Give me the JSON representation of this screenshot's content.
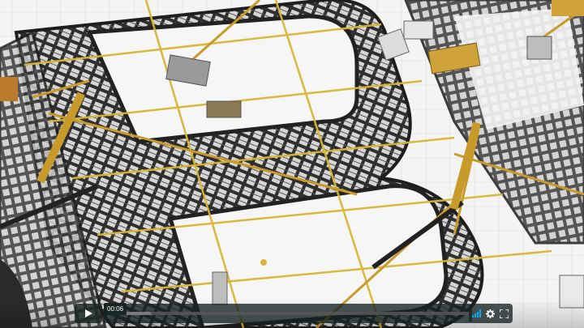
{
  "player": {
    "current_time": "00:06",
    "progress_fraction": 0.035,
    "loaded_fraction": 0.12,
    "accent_color": "#00adef"
  },
  "controls": {
    "play_icon": "play-icon",
    "volume_icon": "volume-bars-icon",
    "settings_icon": "gear-icon",
    "fullscreen_icon": "fullscreen-icon"
  }
}
